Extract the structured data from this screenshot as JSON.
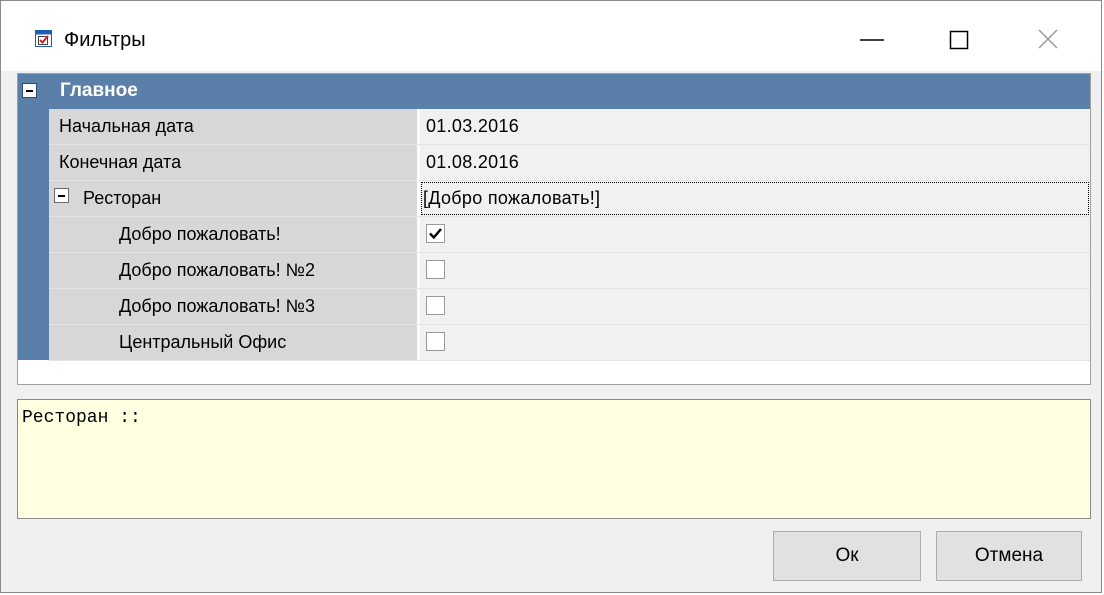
{
  "window": {
    "title": "Фильтры",
    "icon": "checkbox-form-icon",
    "controls": [
      "minimize-icon",
      "maximize-icon",
      "close-icon"
    ]
  },
  "grid": {
    "category": {
      "label": "Главное",
      "expanded": true
    },
    "rows": [
      {
        "name": "Начальная дата",
        "value": "01.03.2016"
      },
      {
        "name": "Конечная дата",
        "value": "01.08.2016"
      },
      {
        "name": "Ресторан",
        "value": "[Добро пожаловать!]",
        "expanded": true,
        "focused": true
      }
    ],
    "restaurants": [
      {
        "name": "Добро пожаловать!",
        "checked": true
      },
      {
        "name": "Добро пожаловать! №2",
        "checked": false
      },
      {
        "name": "Добро пожаловать! №3",
        "checked": false
      },
      {
        "name": "Центральный Офис",
        "checked": false
      }
    ]
  },
  "description": {
    "text": "Ресторан ::"
  },
  "buttons": {
    "ok": "Ок",
    "cancel": "Отмена"
  },
  "colors": {
    "category_bg": "#5a7fa8",
    "description_bg": "#ffffe1"
  }
}
